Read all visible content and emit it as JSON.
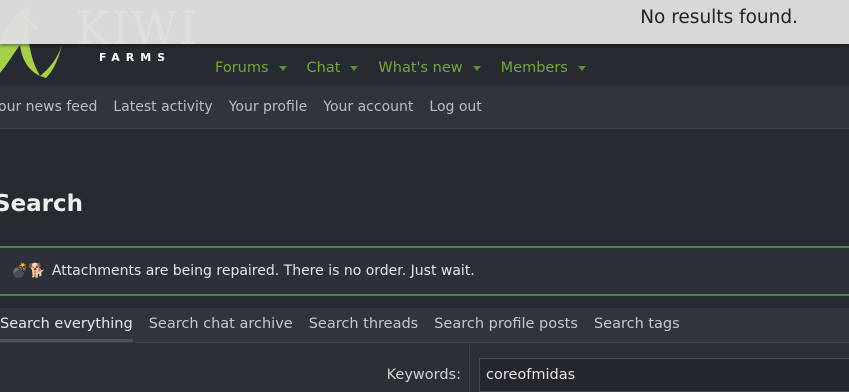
{
  "brand": {
    "name": "KIWI",
    "sub": "FARMS"
  },
  "nav": [
    {
      "label": "Forums"
    },
    {
      "label": "Chat"
    },
    {
      "label": "What's new"
    },
    {
      "label": "Members"
    }
  ],
  "subnav": [
    "our news feed",
    "Latest activity",
    "Your profile",
    "Your account",
    "Log out"
  ],
  "page_title": "Search",
  "notice": {
    "emoji": "💣🐕",
    "text": "Attachments are being repaired. There is no order. Just wait."
  },
  "tabs": [
    "Search everything",
    "Search chat archive",
    "Search threads",
    "Search profile posts",
    "Search tags"
  ],
  "form": {
    "keywords_label": "Keywords:",
    "keywords_value": "coreofmidas"
  },
  "toast": "No results found.",
  "colors": {
    "accent": "#73a83a",
    "notice_border": "#53843a",
    "background": "#262a31"
  }
}
